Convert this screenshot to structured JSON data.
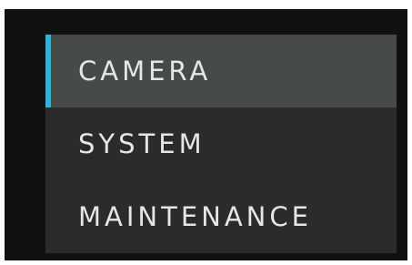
{
  "menu": {
    "items": [
      {
        "label": "CAMERA",
        "selected": true
      },
      {
        "label": "SYSTEM",
        "selected": false
      },
      {
        "label": "MAINTENANCE",
        "selected": false
      }
    ]
  },
  "colors": {
    "accent": "#29b6d8",
    "selected_bg": "#474b47",
    "menu_bg": "#2b2b2b",
    "frame_bg": "#111111",
    "text": "#e6e6e6"
  }
}
